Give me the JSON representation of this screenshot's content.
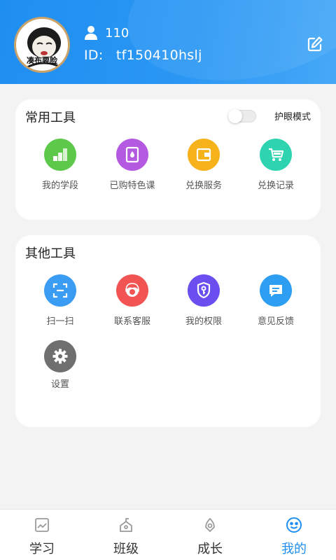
{
  "profile": {
    "avatar_caption": "凑布要脸",
    "user_count": "110",
    "id_label": "ID:",
    "id_value": "tf150410hslj"
  },
  "common_tools": {
    "title": "常用工具",
    "eye_mode_label": "护眼模式",
    "eye_mode_on": false,
    "items": [
      {
        "label": "我的学段",
        "icon": "stairs-icon",
        "color": "#5cc94a"
      },
      {
        "label": "已购特色课",
        "icon": "book-icon",
        "color": "#b45ae0"
      },
      {
        "label": "兑换服务",
        "icon": "wallet-icon",
        "color": "#f5b21b"
      },
      {
        "label": "兑换记录",
        "icon": "cart-icon",
        "color": "#2ed3b0"
      }
    ]
  },
  "other_tools": {
    "title": "其他工具",
    "items": [
      {
        "label": "扫一扫",
        "icon": "scan-icon",
        "color": "#3b9cf4"
      },
      {
        "label": "联系客服",
        "icon": "customer-service-icon",
        "color": "#f25454"
      },
      {
        "label": "我的权限",
        "icon": "key-shield-icon",
        "color": "#6a4ef0"
      },
      {
        "label": "意见反馈",
        "icon": "chat-icon",
        "color": "#2e9ef2"
      },
      {
        "label": "设置",
        "icon": "gear-icon",
        "color": "#6f6f6f"
      }
    ]
  },
  "tabbar": {
    "active": 3,
    "accent": "#1f8ef1",
    "items": [
      {
        "label": "学习",
        "icon": "study-icon"
      },
      {
        "label": "班级",
        "icon": "class-icon"
      },
      {
        "label": "成长",
        "icon": "growth-icon"
      },
      {
        "label": "我的",
        "icon": "smiley-icon"
      }
    ]
  }
}
